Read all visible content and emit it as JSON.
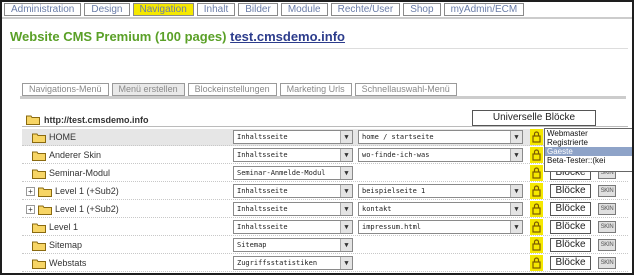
{
  "topnav": {
    "tabs": [
      {
        "label": "Administration",
        "active": false
      },
      {
        "label": "Design",
        "active": false
      },
      {
        "label": "Navigation",
        "active": true
      },
      {
        "label": "Inhalt",
        "active": false
      },
      {
        "label": "Bilder",
        "active": false
      },
      {
        "label": "Module",
        "active": false
      },
      {
        "label": "Rechte/User",
        "active": false
      },
      {
        "label": "Shop",
        "active": false
      },
      {
        "label": "myAdmin/ECM",
        "active": false
      }
    ]
  },
  "site": {
    "title": "Website CMS Premium (100 pages)",
    "url": "test.cmsdemo.info"
  },
  "subtabs": [
    {
      "label": "Navigations-Menü",
      "active": false
    },
    {
      "label": "Menü erstellen",
      "active": true
    },
    {
      "label": "Blockeinstellungen",
      "active": false
    },
    {
      "label": "Marketing Urls",
      "active": false
    },
    {
      "label": "Schnellauswahl-Menü",
      "active": false
    }
  ],
  "tree": {
    "root_url": "http://test.cmsdemo.info",
    "universal_blocks_label": "Universelle Blöcke",
    "blocks_label": "Blöcke",
    "skin_label": "SKIN",
    "rows": [
      {
        "name": "HOME",
        "type": "Inhaltsseite",
        "page": "home / startseite",
        "expander": "",
        "indent": 0
      },
      {
        "name": "Anderer Skin",
        "type": "Inhaltsseite",
        "page": "wo-finde-ich-was",
        "expander": "",
        "indent": 0
      },
      {
        "name": "Seminar-Modul",
        "type": "Seminar-Anmelde-Modul",
        "page": "",
        "expander": "",
        "indent": 0
      },
      {
        "name": "Level 1 (+Sub2)",
        "type": "Inhaltsseite",
        "page": "beispielseite 1",
        "expander": "+",
        "indent": 0
      },
      {
        "name": "Level 1 (+Sub2)",
        "type": "Inhaltsseite",
        "page": "kontakt",
        "expander": "+",
        "indent": 0
      },
      {
        "name": "Level 1",
        "type": "Inhaltsseite",
        "page": "impressum.html",
        "expander": "",
        "indent": 0
      },
      {
        "name": "Sitemap",
        "type": "Sitemap",
        "page": "",
        "expander": "",
        "indent": 0
      },
      {
        "name": "Webstats",
        "type": "Zugriffsstatistiken",
        "page": "",
        "expander": "",
        "indent": 0
      }
    ]
  },
  "rights_listbox": {
    "options": [
      "Webmaster",
      "Registrierte",
      "Gaeste",
      "Beta-Tester::(kei"
    ],
    "highlighted_index": 2
  },
  "colors": {
    "accent_yellow": "#f5e800",
    "title_green": "#5aa027",
    "link_blue": "#2c3c8c",
    "listbox_highlight": "#8ea3c8"
  }
}
